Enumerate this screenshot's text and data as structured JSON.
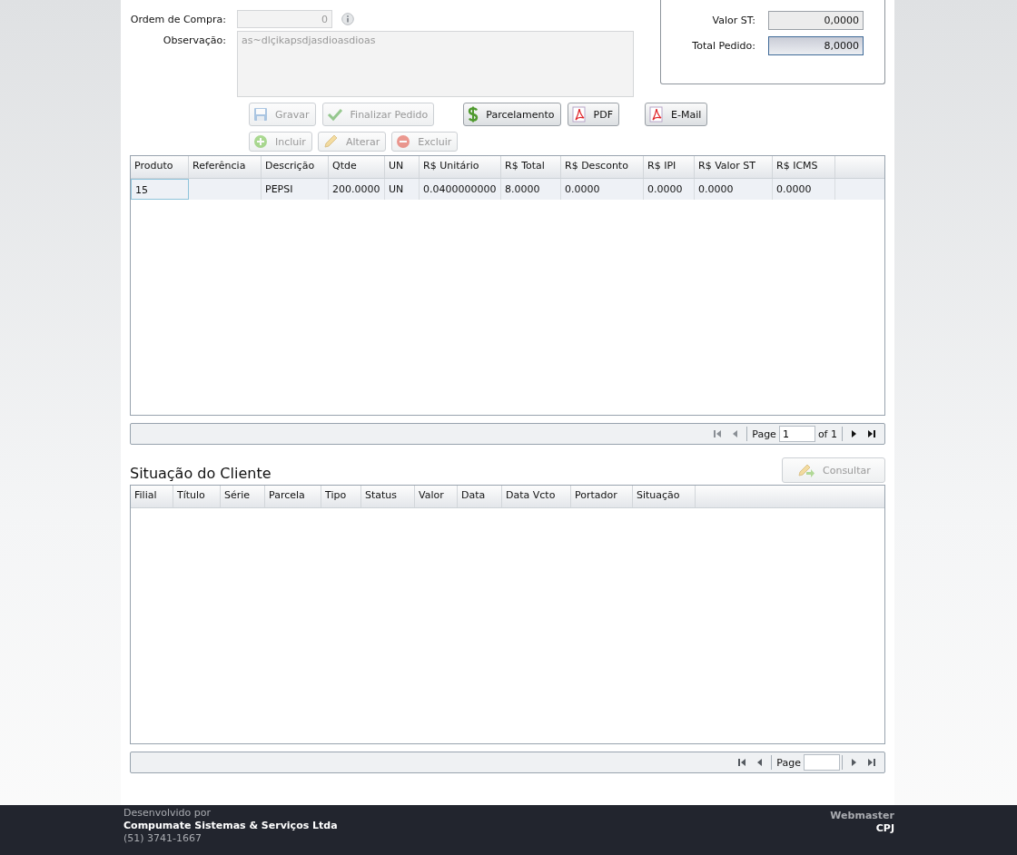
{
  "form": {
    "fields": [
      {
        "label": "Ordem de Compra:",
        "value": "0",
        "info": true,
        "disabled": true
      }
    ],
    "observation": {
      "label": "Observação:",
      "value": "as~dlçikapsdjasdioasdioas",
      "disabled": true
    }
  },
  "totals": [
    {
      "label": "Valor ST:",
      "value": "0,0000",
      "highlight": false
    },
    {
      "label": "Total Pedido:",
      "value": "8,0000",
      "highlight": true
    }
  ],
  "button_rows": [
    [
      [
        {
          "kind": "save",
          "label": "Gravar",
          "disabled": true
        },
        {
          "kind": "finish",
          "label": "Finalizar Pedido",
          "disabled": true
        }
      ],
      [
        {
          "kind": "installments",
          "label": "Parcelamento",
          "disabled": false
        },
        {
          "kind": "pdf",
          "label": "PDF",
          "disabled": false
        }
      ],
      [
        {
          "kind": "email",
          "label": "E-Mail",
          "disabled": false
        }
      ]
    ],
    [
      [
        {
          "kind": "add",
          "label": "Incluir",
          "disabled": true
        },
        {
          "kind": "edit",
          "label": "Alterar",
          "disabled": true
        },
        {
          "kind": "delete",
          "label": "Excluir",
          "disabled": true
        }
      ]
    ]
  ],
  "items_grid": {
    "columns": [
      "Produto",
      "Referência",
      "Descrição",
      "Qtde",
      "UN",
      "R$ Unitário",
      "R$ Total",
      "R$ Desconto",
      "R$ IPI",
      "R$ Valor ST",
      "R$ ICMS"
    ],
    "rows": [
      {
        "selected": true,
        "cells": [
          "15",
          "",
          "PEPSI",
          "200.0000",
          "UN",
          "0.0400000000",
          "8.0000",
          "0.0000",
          "0.0000",
          "0.0000",
          "0.0000"
        ]
      }
    ],
    "pager": {
      "label": "Page",
      "page": "1",
      "of": "of 1",
      "buttons": [
        {
          "kind": "first",
          "disabled": true
        },
        {
          "kind": "prev",
          "disabled": true
        },
        {
          "kind": "next",
          "disabled": false
        },
        {
          "kind": "last",
          "disabled": false
        }
      ]
    }
  },
  "client_status": {
    "title": "Situação do Cliente",
    "button": {
      "label": "Consultar",
      "disabled": true
    },
    "columns": [
      "Filial",
      "Título",
      "Série",
      "Parcela",
      "Tipo",
      "Status",
      "Valor",
      "Data",
      "Data Vcto",
      "Portador",
      "Situação"
    ],
    "pager": {
      "label": "Page",
      "buttons": [
        {
          "kind": "first",
          "disabled": false
        },
        {
          "kind": "prev",
          "disabled": false
        },
        {
          "kind": "next",
          "disabled": false
        },
        {
          "kind": "last",
          "disabled": false
        }
      ]
    }
  },
  "footer": {
    "developed_by": "Desenvolvido por",
    "company": "Compumate Sistemas & Serviços Ltda",
    "phone": "(51) 3741-1667",
    "webmaster_label": "Webmaster",
    "webmaster": "CPJ"
  }
}
